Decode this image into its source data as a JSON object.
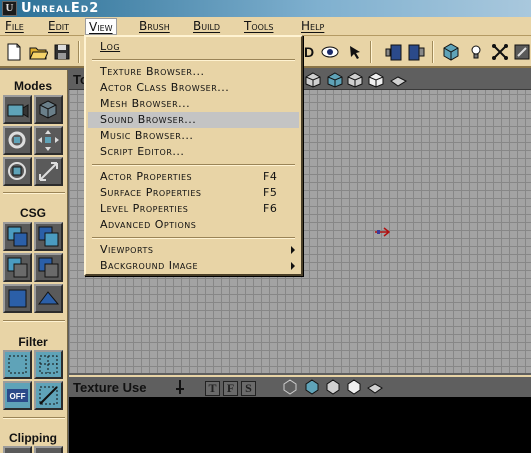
{
  "window": {
    "title": "UnrealEd2",
    "app_icon": "unreal-logo"
  },
  "menubar": {
    "items": [
      {
        "label": "File"
      },
      {
        "label": "Edit"
      },
      {
        "label": "View"
      },
      {
        "label": "Brush"
      },
      {
        "label": "Build"
      },
      {
        "label": "Tools"
      },
      {
        "label": "Help"
      }
    ],
    "open": "View"
  },
  "view_menu": {
    "items": [
      {
        "label": "Log",
        "shortcut": ""
      },
      {
        "label": "Texture Browser...",
        "shortcut": ""
      },
      {
        "label": "Actor Class Browser...",
        "shortcut": ""
      },
      {
        "label": "Mesh Browser...",
        "shortcut": ""
      },
      {
        "label": "Sound Browser...",
        "shortcut": "",
        "highlighted": true
      },
      {
        "label": "Music Browser...",
        "shortcut": ""
      },
      {
        "label": "Script Editor...",
        "shortcut": ""
      },
      {
        "label": "Actor Properties",
        "shortcut": "F4"
      },
      {
        "label": "Surface Properties",
        "shortcut": "F5"
      },
      {
        "label": "Level Properties",
        "shortcut": "F6"
      },
      {
        "label": "Advanced Options",
        "shortcut": ""
      },
      {
        "label": "Viewports",
        "submenu": true
      },
      {
        "label": "Background Image",
        "submenu": true
      }
    ]
  },
  "toolbar": {
    "icons": [
      "new-icon",
      "open-icon",
      "save-icon",
      "3d-icon",
      "eye-icon",
      "actor-properties-icon",
      "surface-properties-icon",
      "cube-icon",
      "lightbulb-icon",
      "links-icon",
      "settings-icon"
    ]
  },
  "left_panel": {
    "sections": [
      {
        "title": "Modes"
      },
      {
        "title": "CSG"
      },
      {
        "title": "Filter"
      },
      {
        "title": "Clipping"
      }
    ],
    "filter_off_label": "OFF"
  },
  "viewport": {
    "label": "To"
  },
  "texture_use": {
    "label": "Texture Use",
    "toggles": [
      "T",
      "F",
      "S"
    ]
  },
  "colors": {
    "panel": "#e8d4a6",
    "highlight": "#c4c4c4",
    "grid": "#a3a3a3",
    "title_bar": "#2a6f95"
  }
}
